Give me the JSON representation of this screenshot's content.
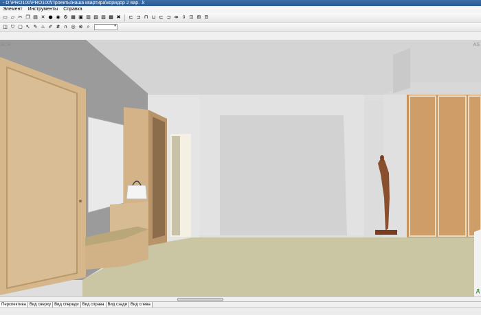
{
  "window": {
    "title": "- D:\\PRO100\\PRO100\\Проекты\\наша квартира\\коридор 2 вар. .k"
  },
  "menu": [
    "Элемент",
    "Инструменты",
    "Справка"
  ],
  "toolbar1": [
    {
      "icon": "folder-icon",
      "glyph": "▭"
    },
    {
      "icon": "open-icon",
      "glyph": "▱"
    },
    {
      "icon": "cut-icon",
      "glyph": "✂"
    },
    {
      "icon": "copy-icon",
      "glyph": "❐"
    },
    {
      "icon": "paste-icon",
      "glyph": "▤"
    },
    {
      "icon": "delete-icon",
      "glyph": "✕"
    },
    {
      "icon": "globe-icon",
      "glyph": "●"
    },
    {
      "icon": "sphere-icon",
      "glyph": "◉"
    },
    {
      "icon": "settings-icon",
      "glyph": "⚙"
    },
    {
      "icon": "view-icon",
      "glyph": "▦"
    },
    {
      "icon": "view2-icon",
      "glyph": "▣"
    },
    {
      "icon": "view3-icon",
      "glyph": "▥"
    },
    {
      "icon": "view4-icon",
      "glyph": "▧"
    },
    {
      "icon": "view5-icon",
      "glyph": "▨"
    },
    {
      "icon": "view6-icon",
      "glyph": "▩"
    },
    {
      "icon": "cross-icon",
      "glyph": "✖"
    }
  ],
  "toolbar1_right": [
    {
      "icon": "align-left-icon",
      "glyph": "⊏"
    },
    {
      "icon": "align-center-icon",
      "glyph": "⊐"
    },
    {
      "icon": "align-right-icon",
      "glyph": "⊓"
    },
    {
      "icon": "align-top-icon",
      "glyph": "⊔"
    },
    {
      "icon": "align-middle-icon",
      "glyph": "⊏"
    },
    {
      "icon": "align-bottom-icon",
      "glyph": "⊐"
    },
    {
      "icon": "distribute-h-icon",
      "glyph": "⇹"
    },
    {
      "icon": "distribute-v-icon",
      "glyph": "⇳"
    },
    {
      "icon": "size-icon",
      "glyph": "⊡"
    },
    {
      "icon": "size2-icon",
      "glyph": "⊞"
    },
    {
      "icon": "size3-icon",
      "glyph": "⊟"
    }
  ],
  "toolbar2": [
    {
      "icon": "cube-icon",
      "glyph": "◫"
    },
    {
      "icon": "shield-icon",
      "glyph": "⛉"
    },
    {
      "icon": "select-icon",
      "glyph": "▢"
    },
    {
      "icon": "pointer-icon",
      "glyph": "↖"
    },
    {
      "icon": "paint-icon",
      "glyph": "✎"
    },
    {
      "icon": "light-icon",
      "glyph": "♨"
    },
    {
      "icon": "pencil-icon",
      "glyph": "✐"
    },
    {
      "icon": "grid-icon",
      "glyph": "#"
    },
    {
      "icon": "magnet-icon",
      "glyph": "∩"
    },
    {
      "icon": "target-icon",
      "glyph": "◎"
    },
    {
      "icon": "stop-icon",
      "glyph": "⊗"
    },
    {
      "icon": "zoom-icon",
      "glyph": "⌕"
    }
  ],
  "zoom": {
    "value": ""
  },
  "view_labels": {
    "left": "ВСЯ",
    "right": "AS",
    "bottom_right": "Д",
    "bottom_left": ""
  },
  "tabs": [
    {
      "label": "Перспектива",
      "active": true
    },
    {
      "label": "Вид сверху",
      "active": false
    },
    {
      "label": "Вид спереди",
      "active": false
    },
    {
      "label": "Вид справа",
      "active": false
    },
    {
      "label": "Вид сзади",
      "active": false
    },
    {
      "label": "Вид слева",
      "active": false
    }
  ],
  "colors": {
    "titlebar": "#2b5a93",
    "floor": "#cbc7a6",
    "wood": "#d4b48a",
    "wall_grey": "#9a9a9a",
    "wall_light": "#e3e3e3"
  }
}
